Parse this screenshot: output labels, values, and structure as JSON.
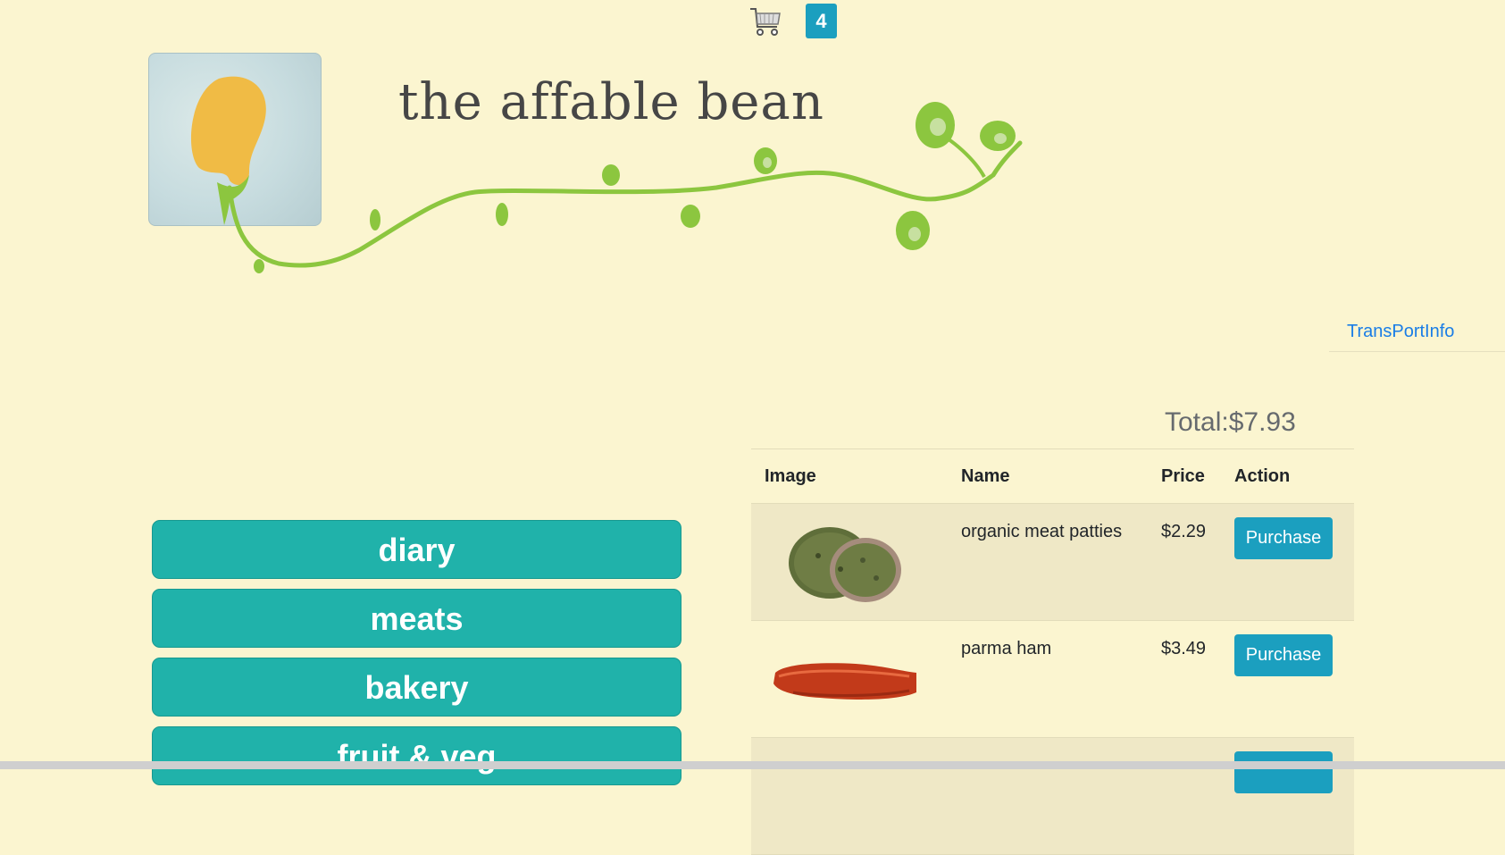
{
  "header": {
    "cart_icon": "shopping-cart-icon",
    "cart_count": "4"
  },
  "banner": {
    "title": "the affable bean",
    "logo_icon": "bean-logo-icon"
  },
  "nav": {
    "transport_link": "TransPortInfo"
  },
  "cart": {
    "total_label": "Total:$7.93",
    "columns": [
      "Image",
      "Name",
      "Price",
      "Action"
    ],
    "rows": [
      {
        "name": "organic meat patties",
        "price": "$2.29",
        "action": "Purchase",
        "image_icon": "meat-patties-image"
      },
      {
        "name": "parma ham",
        "price": "$3.49",
        "action": "Purchase",
        "image_icon": "parma-ham-image"
      }
    ]
  },
  "categories": [
    {
      "label": "diary"
    },
    {
      "label": "meats"
    },
    {
      "label": "bakery"
    },
    {
      "label": "fruit & veg"
    }
  ],
  "colors": {
    "background": "#fbf5d0",
    "accent": "#1b9fbf",
    "category": "#20b2aa",
    "link": "#1a7de6"
  }
}
